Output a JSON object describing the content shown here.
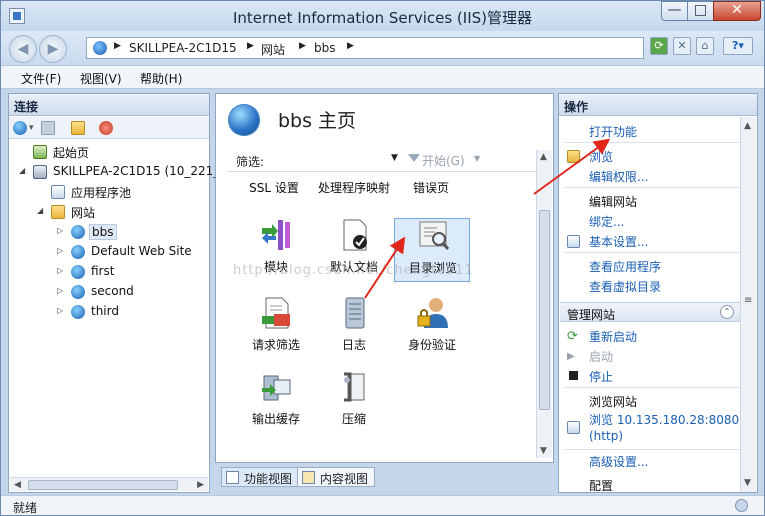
{
  "window": {
    "title": "Internet Information Services (IIS)管理器",
    "minimize": "—",
    "maximize": "□",
    "close": "✕"
  },
  "address": {
    "crumbs": [
      "SKILLPEA-2C1D15",
      "网站",
      "bbs"
    ]
  },
  "menu": [
    "文件(F)",
    "视图(V)",
    "帮助(H)"
  ],
  "connections": {
    "title": "连接",
    "tree": [
      {
        "label": "起始页"
      },
      {
        "label": "SKILLPEA-2C1D15 (10_221_"
      },
      {
        "label": "应用程序池"
      },
      {
        "label": "网站"
      },
      {
        "label": "bbs"
      },
      {
        "label": "Default Web Site"
      },
      {
        "label": "first"
      },
      {
        "label": "second"
      },
      {
        "label": "third"
      }
    ]
  },
  "main": {
    "title": "bbs 主页",
    "filter_label": "筛选:",
    "start_label": "开始(G)",
    "categories": [
      "SSL 设置",
      "处理程序映射",
      "错误页"
    ],
    "features": [
      {
        "label": "模块"
      },
      {
        "label": "默认文档"
      },
      {
        "label": "目录浏览"
      },
      {
        "label": "请求筛选"
      },
      {
        "label": "日志"
      },
      {
        "label": "身份验证"
      },
      {
        "label": "输出缓存"
      },
      {
        "label": "压缩"
      }
    ],
    "tabs": [
      "功能视图",
      "内容视图"
    ],
    "watermark": "http://blog.csdn.net/chengtao11"
  },
  "actions": {
    "title": "操作",
    "open_feature": "打开功能",
    "explore": "浏览",
    "edit_permissions": "编辑权限...",
    "edit_site": "编辑网站",
    "bindings": "绑定...",
    "basic_settings": "基本设置...",
    "view_apps": "查看应用程序",
    "view_vdirs": "查看虚拟目录",
    "manage_site": "管理网站",
    "restart": "重新启动",
    "start": "启动",
    "stop": "停止",
    "browse_site": "浏览网站",
    "browse_url": "浏览 10.135.180.28:8080",
    "browse_proto": "(http)",
    "advanced": "高级设置...",
    "configure": "配置"
  },
  "status": {
    "text": "就绪"
  },
  "colors": {
    "accent": "#1a5fb4",
    "arrow": "#e0261b"
  }
}
